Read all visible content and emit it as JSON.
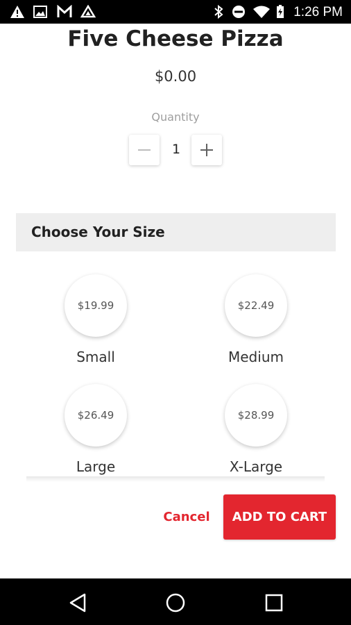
{
  "status_bar": {
    "time": "1:26 PM",
    "left_icons": [
      "warning-icon",
      "image-icon",
      "gmail-icon",
      "drive-icon"
    ],
    "right_icons": [
      "bluetooth-icon",
      "do-not-disturb-icon",
      "wifi-icon",
      "battery-charging-icon"
    ]
  },
  "product": {
    "title": "Five Cheese Pizza",
    "price": "$0.00"
  },
  "quantity": {
    "label": "Quantity",
    "value": "1",
    "decrement_icon": "minus-icon",
    "increment_icon": "plus-icon"
  },
  "size_section": {
    "header": "Choose Your Size",
    "options": [
      {
        "name": "Small",
        "price": "$19.99"
      },
      {
        "name": "Medium",
        "price": "$22.49"
      },
      {
        "name": "Large",
        "price": "$26.49"
      },
      {
        "name": "X-Large",
        "price": "$28.99"
      }
    ]
  },
  "actions": {
    "cancel_label": "Cancel",
    "add_label": "ADD TO CART"
  },
  "colors": {
    "accent": "#e3262f",
    "section_bg": "#eeeeee"
  },
  "nav_bar": {
    "icons": [
      "back-icon",
      "home-icon",
      "recents-icon"
    ]
  }
}
